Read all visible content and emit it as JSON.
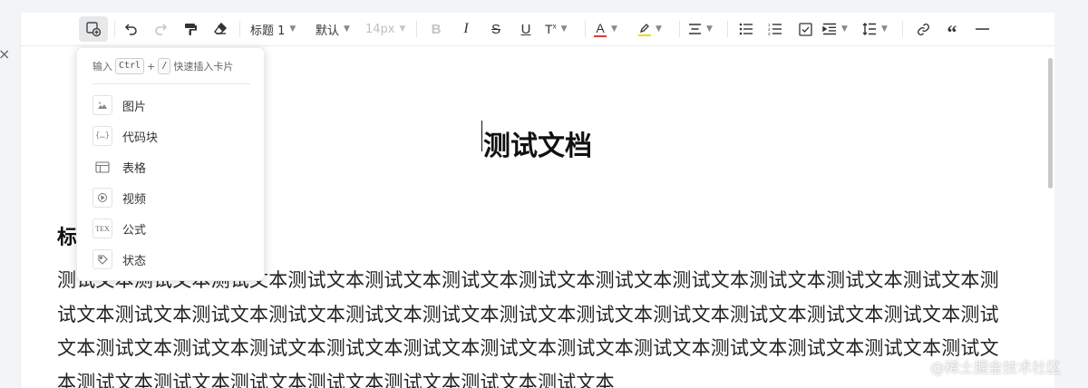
{
  "toolbar": {
    "heading_label": "标题 1",
    "font_label": "默认",
    "size_label": "14px",
    "colors": {
      "font_color_bar": "#e53935",
      "highlight_bar": "#f5d90a"
    }
  },
  "insert_menu": {
    "hint_prefix": "输入",
    "hint_key1": "Ctrl",
    "hint_plus": "+",
    "hint_key2": "/",
    "hint_suffix": "快速插入卡片",
    "items": [
      {
        "label": "图片",
        "icon": "image-icon"
      },
      {
        "label": "代码块",
        "icon": "code-block-icon"
      },
      {
        "label": "表格",
        "icon": "table-icon"
      },
      {
        "label": "视频",
        "icon": "video-icon"
      },
      {
        "label": "公式",
        "icon": "formula-icon"
      },
      {
        "label": "状态",
        "icon": "status-icon"
      }
    ]
  },
  "document": {
    "title": "测试文档",
    "heading1": "标题一",
    "body": "测试文本测试文本测试文本测试文本测试文本测试文本测试文本测试文本测试文本测试文本测试文本测试文本测试文本测试文本测试文本测试文本测试文本测试文本测试文本测试文本测试文本测试文本测试文本测试文本测试文本测试文本测试文本测试文本测试文本测试文本测试文本测试文本测试文本测试文本测试文本测试文本测试文本测试文本测试文本测试文本测试文本测试文本测试文本测试文本"
  },
  "watermark": "@稀土掘金技术社区"
}
